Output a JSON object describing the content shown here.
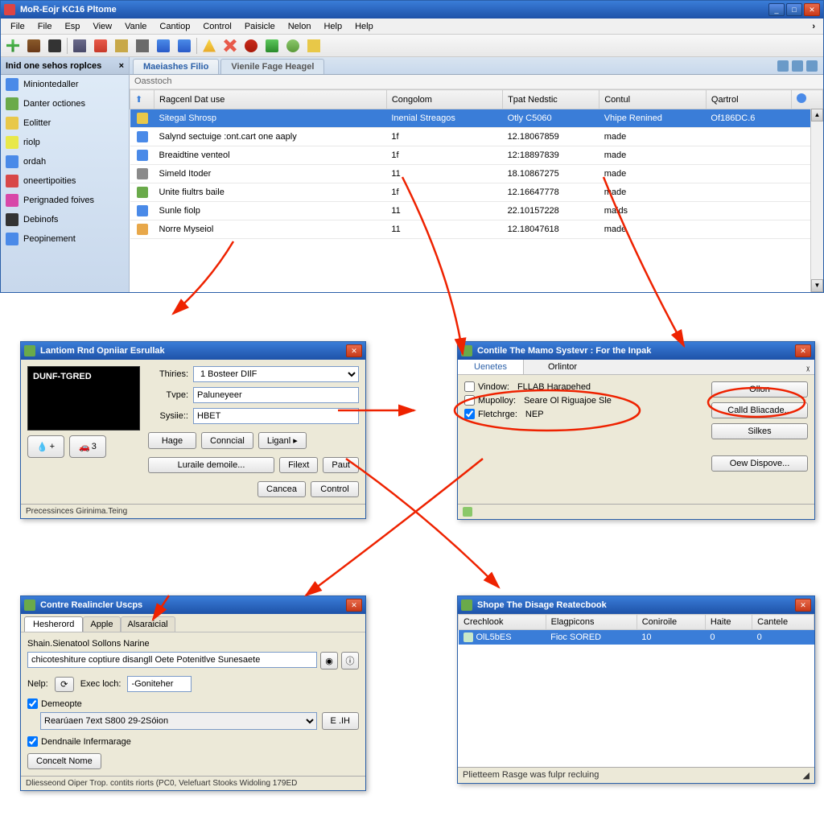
{
  "main_window": {
    "title": "MoR-Eojr KC16 Pltome",
    "menu": [
      "File",
      "File",
      "Esp",
      "View",
      "Vanle",
      "Cantiop",
      "Control",
      "Paisicle",
      "Nelon",
      "Help",
      "Help"
    ],
    "sidebar_title": "Inid one sehos roplces",
    "sidebar_items": [
      {
        "label": "Miniontedaller",
        "color": "#4a8ae8"
      },
      {
        "label": "Danter octiones",
        "color": "#6aaa4a"
      },
      {
        "label": "Eolitter",
        "color": "#e8c84a"
      },
      {
        "label": "riolp",
        "color": "#e8e84a"
      },
      {
        "label": "ordah",
        "color": "#4a8ae8"
      },
      {
        "label": "oneertipoities",
        "color": "#d84848"
      },
      {
        "label": "Perignaded foives",
        "color": "#d848a8"
      },
      {
        "label": "Debinofs",
        "color": "#333"
      },
      {
        "label": "Peopinement",
        "color": "#4a8ae8"
      }
    ],
    "tabs": [
      "Maeiashes Filio",
      "Vienile Fage Heagel"
    ],
    "subhead": "Oasstoch",
    "columns": [
      "",
      "Ragcenl Dat use",
      "Congolom",
      "Tpat Nedstic",
      "Contul",
      "Qartrol",
      ""
    ],
    "rows": [
      {
        "name": "Sitegal Shrosp",
        "c1": "Inenial Streagos",
        "c2": "Otly C5060",
        "c3": "Vhipe Renined",
        "c4": "Of186DC.6",
        "sel": true,
        "ico": "#e8c84a"
      },
      {
        "name": "Salynd sectuige :ont.cart one aaply",
        "c1": "1f",
        "c2": "12.18067859",
        "c3": "made",
        "c4": "",
        "ico": "#4a8ae8"
      },
      {
        "name": "Breaidtine venteol",
        "c1": "1f",
        "c2": "12:18897839",
        "c3": "made",
        "c4": "",
        "ico": "#4a8ae8"
      },
      {
        "name": "Simeld Itoder",
        "c1": "11",
        "c2": "18.10867275",
        "c3": "made",
        "c4": "",
        "ico": "#8a8a8a"
      },
      {
        "name": "Unite fiultrs baile",
        "c1": "1f",
        "c2": "12.16647778",
        "c3": "made",
        "c4": "",
        "ico": "#6aaa4a"
      },
      {
        "name": "Sunle fiolp",
        "c1": "11",
        "c2": "22.10157228",
        "c3": "maids",
        "c4": "",
        "ico": "#4a8ae8"
      },
      {
        "name": "Norre Myseiol",
        "c1": "11",
        "c2": "12.18047618",
        "c3": "made",
        "c4": "",
        "ico": "#e8a84a"
      }
    ]
  },
  "dlg1": {
    "title": "Lantiom Rnd Opniiar Esrullak",
    "blackbox": "DUNF-TGRED",
    "labels": {
      "thiries": "Thiries:",
      "type": "Tvpe:",
      "sysile": "Sysiie::"
    },
    "vals": {
      "thiries": "1 Bosteer DIlF",
      "type": "Paluneyeer",
      "sysile": "HBET"
    },
    "btns": {
      "hage": "Hage",
      "conncial": "Conncial",
      "liganl": "Liganl ▸"
    },
    "btns2": {
      "luraile": "Luraile demoile...",
      "filex": "Filext",
      "paut": "Paut"
    },
    "btns3": {
      "cancea": "Cancea",
      "control": "Control"
    },
    "iconbtn1_plus": "+",
    "iconbtn2_num": "3",
    "status": "Precessinces Girinima.Teing"
  },
  "dlg2": {
    "title": "Contile The Mamo Systevr : For the Inpak",
    "tabs": [
      "Uenetes",
      "Orlintor"
    ],
    "chk": {
      "vindow": "Vindow:",
      "mupoloy": "Mupolloy:",
      "fletchrge": "Fletchrge:"
    },
    "vals": {
      "vindow": "FLLAB Harapehed",
      "mupoloy": "Seare Ol Riguajoe Sle",
      "fletchrge": "NEP"
    },
    "btns": {
      "ollon": "Ollon",
      "calld": "Calld Bliacade...",
      "silkes": "Silkes",
      "oew": "Oew Dispove..."
    }
  },
  "dlg3": {
    "title": "Contre Realincler Uscps",
    "tabs": [
      "Hesherord",
      "Apple",
      "Alsaraicial"
    ],
    "section": "Shain.Sienatool Sollons Narine",
    "mainfield": "chicoteshiture coptiure disangll Oete Potenitlve Sunesaete",
    "labels": {
      "nelp": "Nelp:",
      "exec": "Exec loch:"
    },
    "exec_val": "-Goniteher",
    "chk1": "Demeopte",
    "combo": "Rearúaen 7ext S800 29-2Sóion",
    "combo_btn": "E .IH",
    "chk2": "Dendnaile Infermarage",
    "btn": "Concelt Nome",
    "status": "Dliesseond Oiper Trop. contits riorts (PC0, Velefuart Stooks Widoling 179ED"
  },
  "dlg4": {
    "title": "Shope The Disage Reatecbook",
    "columns": [
      "Crechlook",
      "Elagpicons",
      "Coniroile",
      "Haite",
      "Cantele"
    ],
    "row": {
      "name": "OlL5bES",
      "c1": "Fioc SORED",
      "c2": "10",
      "c3": "0",
      "c4": "0"
    },
    "status": "Plietteem Rasge was fulpr recluing"
  }
}
